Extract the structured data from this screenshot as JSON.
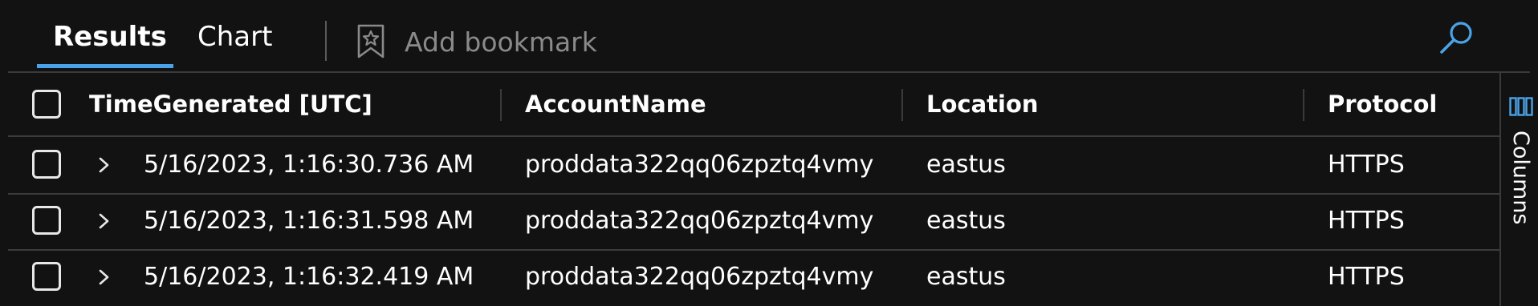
{
  "tabs": {
    "results_label": "Results",
    "chart_label": "Chart",
    "active": "Results"
  },
  "bookmark": {
    "label": "Add bookmark",
    "icon": "bookmark-star-icon"
  },
  "search": {
    "icon": "search-icon"
  },
  "grid": {
    "headers": {
      "time": "TimeGenerated [UTC]",
      "account": "AccountName",
      "location": "Location",
      "protocol": "Protocol"
    },
    "rows": [
      {
        "time": "5/16/2023, 1:16:30.736 AM",
        "account": "proddata322qq06zpztq4vmy",
        "location": "eastus",
        "protocol": "HTTPS"
      },
      {
        "time": "5/16/2023, 1:16:31.598 AM",
        "account": "proddata322qq06zpztq4vmy",
        "location": "eastus",
        "protocol": "HTTPS"
      },
      {
        "time": "5/16/2023, 1:16:32.419 AM",
        "account": "proddata322qq06zpztq4vmy",
        "location": "eastus",
        "protocol": "HTTPS"
      }
    ]
  },
  "side_panel": {
    "label": "Columns",
    "icon": "columns-icon"
  },
  "colors": {
    "background": "#121212",
    "accent": "#4aa3e8",
    "muted_text": "#8a8a8a",
    "text": "#ffffff"
  }
}
